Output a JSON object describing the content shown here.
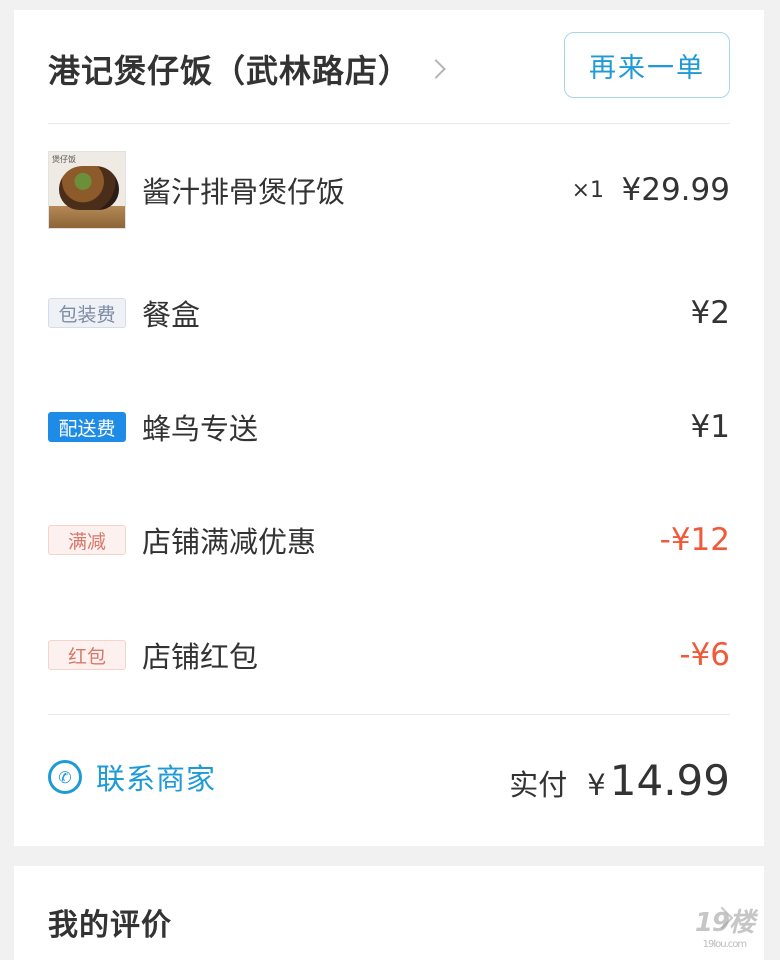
{
  "order": {
    "shop_name": "港记煲仔饭（武林路店）",
    "reorder_label": "再来一单",
    "item": {
      "thumb_label": "煲仔饭",
      "name": "酱汁排骨煲仔饭",
      "qty": "×1",
      "price": "¥29.99"
    },
    "fees": [
      {
        "badge": "包装费",
        "name": "餐盒",
        "amount": "¥2"
      },
      {
        "badge": "配送费",
        "name": "蜂鸟专送",
        "amount": "¥1"
      }
    ],
    "discounts": [
      {
        "badge": "满减",
        "name": "店铺满减优惠",
        "amount": "-¥12"
      },
      {
        "badge": "红包",
        "name": "店铺红包",
        "amount": "-¥6"
      }
    ],
    "contact_label": "联系商家",
    "paid_label": "实付",
    "currency": "¥",
    "total": "14.99"
  },
  "review": {
    "title": "我的评价"
  },
  "watermark": {
    "text": "19楼",
    "sub": "19lou.com"
  },
  "colors": {
    "accent": "#1e9ad6",
    "discount": "#f05a3a",
    "delivery_badge": "#1e8ce6",
    "background": "#f1f1f1"
  },
  "icons": {
    "shop_chevron": "chevron-right-icon",
    "contact": "phone-icon",
    "review_chevron": "chevron-right-icon"
  }
}
